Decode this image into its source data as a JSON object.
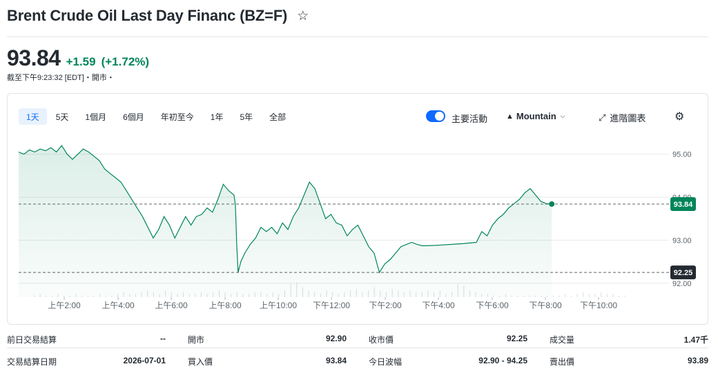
{
  "header": {
    "title": "Brent Crude Oil Last Day Financ (BZ=F)",
    "star_icon": "star-outline-icon"
  },
  "quote": {
    "price": "93.84",
    "change": "+1.59",
    "change_percent": "(+1.72%)",
    "timestamp": "截至下午9:23:32 [EDT]・開市・",
    "up_color": "#008559"
  },
  "ranges": [
    {
      "label": "1天",
      "active": true
    },
    {
      "label": "5天"
    },
    {
      "label": "1個月"
    },
    {
      "label": "6個月"
    },
    {
      "label": "年初至今"
    },
    {
      "label": "1年"
    },
    {
      "label": "5年"
    },
    {
      "label": "全部"
    }
  ],
  "toolbar": {
    "toggle_label": "主要活動",
    "toggle_on": true,
    "chart_type": "Mountain",
    "advanced": "進階圖表",
    "accent": "#0f69ff"
  },
  "chart_data": {
    "type": "area",
    "x_ticks": [
      "上午2:00",
      "上午4:00",
      "上午6:00",
      "上午8:00",
      "上午10:00",
      "下午12:00",
      "下午2:00",
      "下午4:00",
      "下午6:00",
      "下午8:00",
      "下午10:00"
    ],
    "y_ticks": [
      "95.00",
      "94.00",
      "93.00",
      "92.00"
    ],
    "ylim": [
      91.9,
      95.25
    ],
    "current_label": "93.84",
    "previous_close_label": "92.25",
    "current": 93.84,
    "previous_close": 92.25,
    "line_color": "#008559",
    "series": [
      {
        "t": 0.0,
        "v": 95.05
      },
      {
        "t": 0.2,
        "v": 95.0
      },
      {
        "t": 0.4,
        "v": 95.1
      },
      {
        "t": 0.6,
        "v": 95.05
      },
      {
        "t": 0.8,
        "v": 95.12
      },
      {
        "t": 1.0,
        "v": 95.08
      },
      {
        "t": 1.2,
        "v": 95.15
      },
      {
        "t": 1.4,
        "v": 95.05
      },
      {
        "t": 1.6,
        "v": 95.2
      },
      {
        "t": 1.8,
        "v": 95.0
      },
      {
        "t": 2.0,
        "v": 94.88
      },
      {
        "t": 2.2,
        "v": 95.0
      },
      {
        "t": 2.4,
        "v": 95.12
      },
      {
        "t": 2.6,
        "v": 95.05
      },
      {
        "t": 2.8,
        "v": 94.95
      },
      {
        "t": 3.0,
        "v": 94.85
      },
      {
        "t": 3.2,
        "v": 94.65
      },
      {
        "t": 3.4,
        "v": 94.55
      },
      {
        "t": 3.6,
        "v": 94.45
      },
      {
        "t": 3.8,
        "v": 94.35
      },
      {
        "t": 4.0,
        "v": 94.15
      },
      {
        "t": 4.2,
        "v": 93.95
      },
      {
        "t": 4.4,
        "v": 93.75
      },
      {
        "t": 4.6,
        "v": 93.55
      },
      {
        "t": 4.8,
        "v": 93.3
      },
      {
        "t": 5.0,
        "v": 93.05
      },
      {
        "t": 5.2,
        "v": 93.25
      },
      {
        "t": 5.4,
        "v": 93.55
      },
      {
        "t": 5.6,
        "v": 93.35
      },
      {
        "t": 5.8,
        "v": 93.05
      },
      {
        "t": 6.0,
        "v": 93.3
      },
      {
        "t": 6.2,
        "v": 93.55
      },
      {
        "t": 6.4,
        "v": 93.35
      },
      {
        "t": 6.6,
        "v": 93.55
      },
      {
        "t": 6.8,
        "v": 93.6
      },
      {
        "t": 7.0,
        "v": 93.75
      },
      {
        "t": 7.2,
        "v": 93.65
      },
      {
        "t": 7.4,
        "v": 93.95
      },
      {
        "t": 7.6,
        "v": 94.3
      },
      {
        "t": 7.8,
        "v": 94.15
      },
      {
        "t": 8.0,
        "v": 94.05
      },
      {
        "t": 8.05,
        "v": 93.8
      },
      {
        "t": 8.1,
        "v": 92.9
      },
      {
        "t": 8.15,
        "v": 92.25
      },
      {
        "t": 8.25,
        "v": 92.5
      },
      {
        "t": 8.4,
        "v": 92.7
      },
      {
        "t": 8.6,
        "v": 92.9
      },
      {
        "t": 8.8,
        "v": 93.05
      },
      {
        "t": 9.0,
        "v": 93.3
      },
      {
        "t": 9.2,
        "v": 93.2
      },
      {
        "t": 9.4,
        "v": 93.3
      },
      {
        "t": 9.6,
        "v": 93.15
      },
      {
        "t": 9.8,
        "v": 93.4
      },
      {
        "t": 10.0,
        "v": 93.25
      },
      {
        "t": 10.2,
        "v": 93.55
      },
      {
        "t": 10.4,
        "v": 93.75
      },
      {
        "t": 10.6,
        "v": 94.05
      },
      {
        "t": 10.8,
        "v": 94.35
      },
      {
        "t": 11.0,
        "v": 94.2
      },
      {
        "t": 11.2,
        "v": 93.85
      },
      {
        "t": 11.4,
        "v": 93.5
      },
      {
        "t": 11.6,
        "v": 93.6
      },
      {
        "t": 11.8,
        "v": 93.4
      },
      {
        "t": 12.0,
        "v": 93.35
      },
      {
        "t": 12.2,
        "v": 93.1
      },
      {
        "t": 12.4,
        "v": 93.25
      },
      {
        "t": 12.6,
        "v": 93.35
      },
      {
        "t": 12.8,
        "v": 93.1
      },
      {
        "t": 13.0,
        "v": 92.85
      },
      {
        "t": 13.2,
        "v": 92.7
      },
      {
        "t": 13.4,
        "v": 92.25
      },
      {
        "t": 13.6,
        "v": 92.45
      },
      {
        "t": 13.8,
        "v": 92.55
      },
      {
        "t": 14.0,
        "v": 92.7
      },
      {
        "t": 14.2,
        "v": 92.85
      },
      {
        "t": 14.4,
        "v": 92.9
      },
      {
        "t": 14.6,
        "v": 92.95
      },
      {
        "t": 14.8,
        "v": 92.9
      },
      {
        "t": 15.0,
        "v": 92.87
      },
      {
        "t": 15.5,
        "v": 92.88
      },
      {
        "t": 16.0,
        "v": 92.9
      },
      {
        "t": 16.5,
        "v": 92.92
      },
      {
        "t": 17.0,
        "v": 92.95
      },
      {
        "t": 17.2,
        "v": 93.2
      },
      {
        "t": 17.4,
        "v": 93.1
      },
      {
        "t": 17.6,
        "v": 93.35
      },
      {
        "t": 17.8,
        "v": 93.5
      },
      {
        "t": 18.0,
        "v": 93.6
      },
      {
        "t": 18.2,
        "v": 93.75
      },
      {
        "t": 18.4,
        "v": 93.85
      },
      {
        "t": 18.6,
        "v": 93.95
      },
      {
        "t": 18.8,
        "v": 94.1
      },
      {
        "t": 19.0,
        "v": 94.2
      },
      {
        "t": 19.2,
        "v": 94.05
      },
      {
        "t": 19.4,
        "v": 93.9
      },
      {
        "t": 19.6,
        "v": 93.85
      },
      {
        "t": 19.8,
        "v": 93.84
      }
    ],
    "volume": [
      1,
      2,
      1,
      1,
      2,
      1,
      1,
      2,
      1,
      1,
      1,
      2,
      1,
      1,
      2,
      3,
      2,
      2,
      3,
      4,
      3,
      2,
      4,
      3,
      2,
      3,
      2,
      2,
      3,
      2,
      3,
      4,
      3,
      2,
      3,
      2,
      2,
      3,
      3,
      2,
      3,
      2,
      4,
      8,
      9,
      6,
      4,
      3,
      2,
      4,
      3,
      2,
      3,
      4,
      5,
      3,
      4,
      6,
      4,
      3,
      5,
      4,
      3,
      4,
      3,
      3,
      4,
      3,
      4,
      2,
      3,
      8,
      7,
      4,
      3,
      2,
      2,
      1,
      1,
      2,
      1,
      1,
      1,
      1,
      1,
      1,
      1,
      1,
      1,
      2,
      1,
      2,
      3,
      2,
      2,
      3,
      2,
      2,
      1,
      1
    ]
  },
  "stats": [
    [
      {
        "label": "前日交易結算",
        "value": "--"
      },
      {
        "label": "開市",
        "value": "92.90"
      },
      {
        "label": "收市價",
        "value": "92.25"
      },
      {
        "label": "成交量",
        "value": "1.47千"
      }
    ],
    [
      {
        "label": "交易結算日期",
        "value": "2026-07-01"
      },
      {
        "label": "買入價",
        "value": "93.84"
      },
      {
        "label": "今日波幅",
        "value": "92.90 - 94.25"
      },
      {
        "label": "賣出價",
        "value": "93.89"
      }
    ]
  ]
}
